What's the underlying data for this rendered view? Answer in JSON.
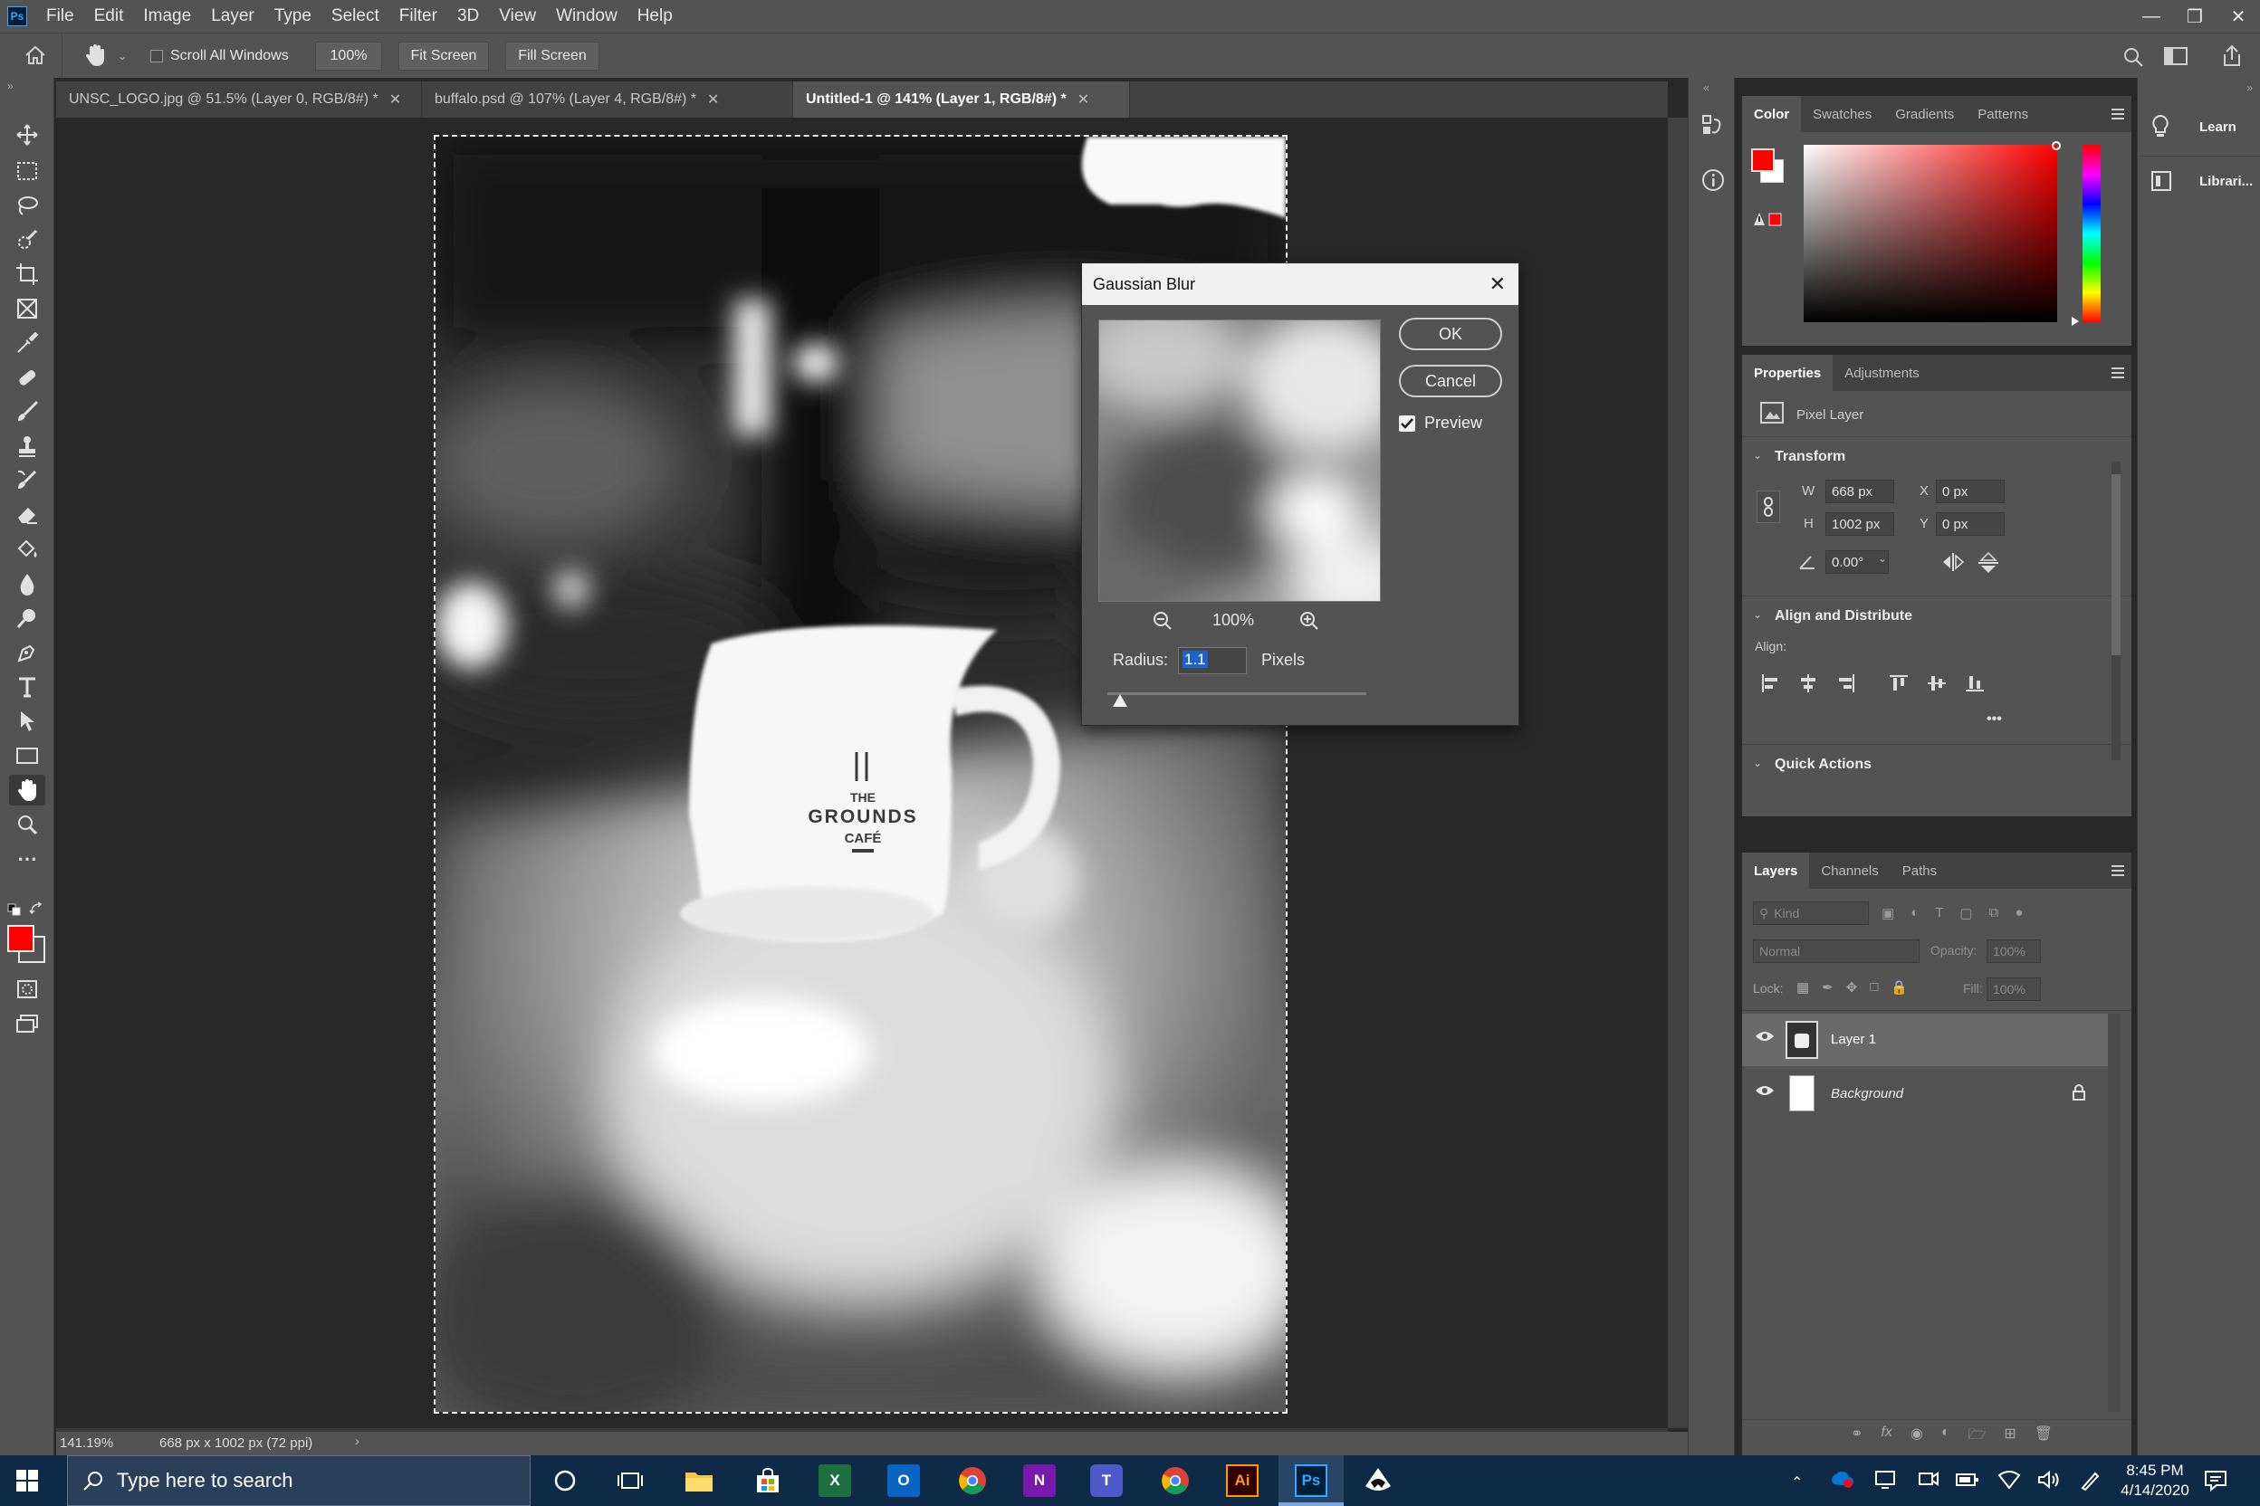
{
  "app": {
    "logo": "Ps",
    "menu": [
      "File",
      "Edit",
      "Image",
      "Layer",
      "Type",
      "Select",
      "Filter",
      "3D",
      "View",
      "Window",
      "Help"
    ]
  },
  "options_bar": {
    "scroll_all_windows": "Scroll All Windows",
    "zoom": "100%",
    "fit_screen": "Fit Screen",
    "fill_screen": "Fill Screen"
  },
  "tabs": [
    {
      "label": "UNSC_LOGO.jpg @ 51.5% (Layer 0, RGB/8#) *",
      "active": false
    },
    {
      "label": "buffalo.psd @ 107% (Layer 4, RGB/8#) *",
      "active": false
    },
    {
      "label": "Untitled-1 @ 141% (Layer 1, RGB/8#) *",
      "active": true
    }
  ],
  "canvas": {
    "cafe_logo_line1": "THE",
    "cafe_logo_line2": "GROUNDS",
    "cafe_logo_line3": "CAFÉ"
  },
  "status": {
    "zoom": "141.19%",
    "doc_size": "668 px x 1002 px (72 ppi)"
  },
  "colors": {
    "foreground": "#ff0000",
    "background": "#ffffff",
    "accent": "#31a8ff"
  },
  "color_panel": {
    "tabs": [
      "Color",
      "Swatches",
      "Gradients",
      "Patterns"
    ],
    "active_tab": "Color"
  },
  "properties_panel": {
    "tabs": [
      "Properties",
      "Adjustments"
    ],
    "layer_type": "Pixel Layer",
    "transform_title": "Transform",
    "w_label": "W",
    "w_value": "668 px",
    "h_label": "H",
    "h_value": "1002 px",
    "x_label": "X",
    "x_value": "0 px",
    "y_label": "Y",
    "y_value": "0 px",
    "angle_value": "0.00°",
    "align_title": "Align and Distribute",
    "align_label": "Align:",
    "more": "•••",
    "quick_actions_title": "Quick Actions"
  },
  "layers_panel": {
    "tabs": [
      "Layers",
      "Channels",
      "Paths"
    ],
    "kind_placeholder": "Kind",
    "blend_mode": "Normal",
    "opacity_label": "Opacity:",
    "opacity_value": "100%",
    "lock_label": "Lock:",
    "fill_label": "Fill:",
    "fill_value": "100%",
    "layers": [
      {
        "name": "Layer 1",
        "visible": true,
        "selected": true
      },
      {
        "name": "Background",
        "visible": true,
        "locked": true
      }
    ]
  },
  "learn_panel": {
    "learn": "Learn",
    "libraries": "Librari..."
  },
  "dialog": {
    "title": "Gaussian Blur",
    "ok": "OK",
    "cancel": "Cancel",
    "preview_label": "Preview",
    "preview_checked": true,
    "zoom": "100%",
    "radius_label": "Radius:",
    "radius_value": "1.1",
    "radius_unit": "Pixels"
  },
  "taskbar": {
    "search_placeholder": "Type here to search",
    "time": "8:45 PM",
    "date": "4/14/2020",
    "apps": [
      "File Explorer",
      "Microsoft Store",
      "Excel",
      "Outlook",
      "Chrome",
      "OneNote",
      "Teams",
      "Chrome",
      "Illustrator",
      "Photoshop",
      "Inkscape"
    ],
    "ai_label": "Ai",
    "ps_label": "Ps",
    "x_label": "X",
    "n_label": "N",
    "o_label": "O",
    "t_label": "T"
  }
}
